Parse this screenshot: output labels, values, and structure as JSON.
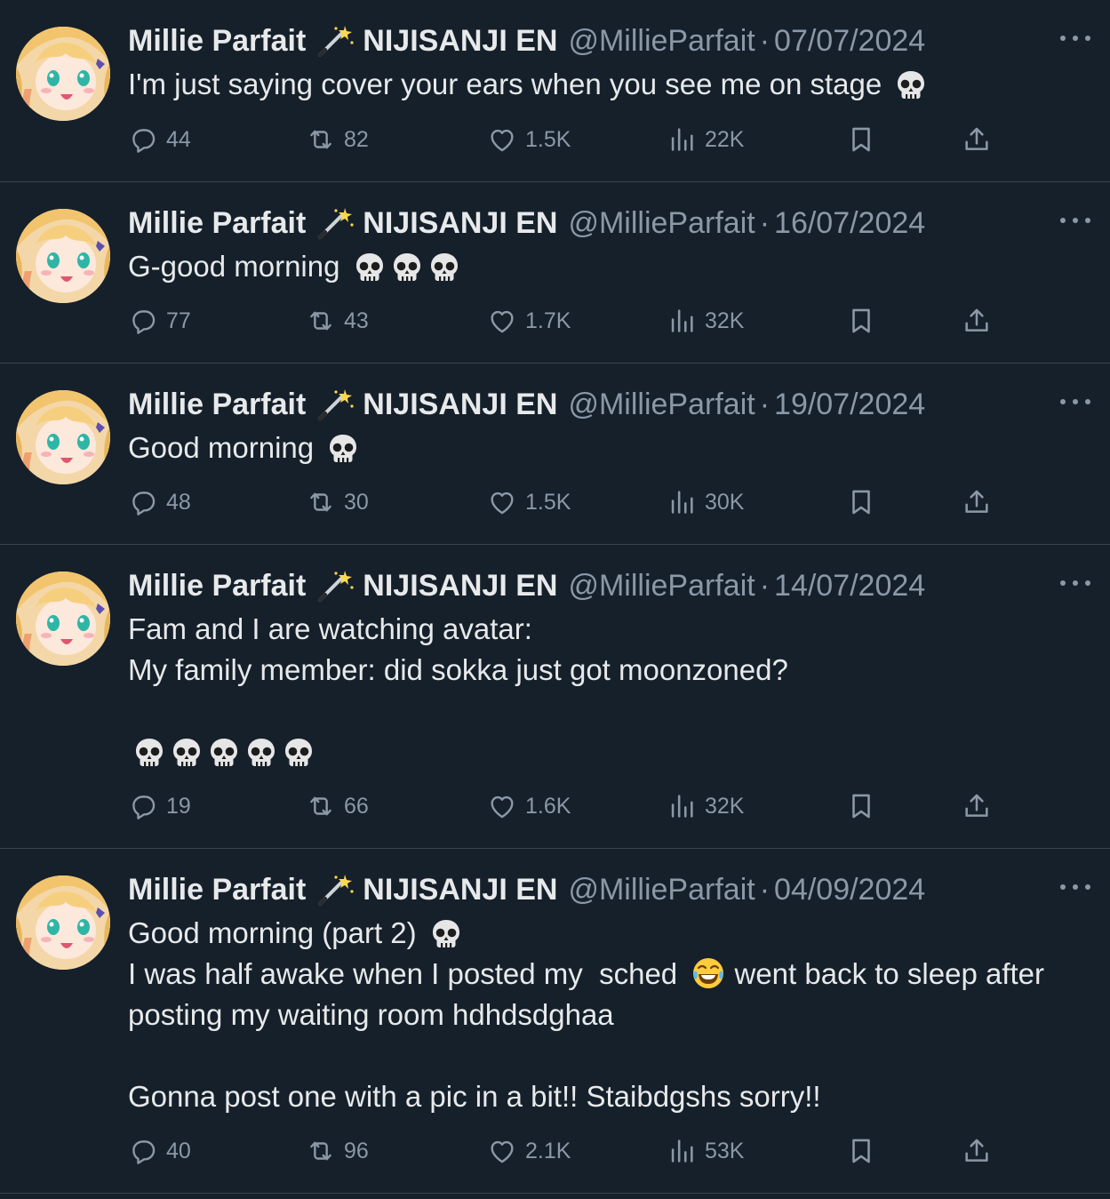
{
  "tweets": [
    {
      "name": "Millie Parfait",
      "org": "NIJISANJI EN",
      "handle": "@MillieParfait",
      "date": "07/07/2024",
      "text_lines": [
        "I'm just saying cover your ears when you see me on stage 💀"
      ],
      "replies": "44",
      "retweets": "82",
      "likes": "1.5K",
      "views": "22K"
    },
    {
      "name": "Millie Parfait",
      "org": "NIJISANJI EN",
      "handle": "@MillieParfait",
      "date": "16/07/2024",
      "text_lines": [
        "G-good morning 💀💀💀"
      ],
      "replies": "77",
      "retweets": "43",
      "likes": "1.7K",
      "views": "32K"
    },
    {
      "name": "Millie Parfait",
      "org": "NIJISANJI EN",
      "handle": "@MillieParfait",
      "date": "19/07/2024",
      "text_lines": [
        "Good morning 💀"
      ],
      "replies": "48",
      "retweets": "30",
      "likes": "1.5K",
      "views": "30K"
    },
    {
      "name": "Millie Parfait",
      "org": "NIJISANJI EN",
      "handle": "@MillieParfait",
      "date": "14/07/2024",
      "text_lines": [
        "Fam and I are watching avatar:",
        "My family member: did sokka just got moonzoned?",
        "",
        "💀💀💀💀💀"
      ],
      "replies": "19",
      "retweets": "66",
      "likes": "1.6K",
      "views": "32K"
    },
    {
      "name": "Millie Parfait",
      "org": "NIJISANJI EN",
      "handle": "@MillieParfait",
      "date": "04/09/2024",
      "text_lines": [
        "Good morning (part 2) 💀",
        "I was half awake when I posted my  sched 😂 went back to sleep after",
        "posting my waiting room hdhdsdghaa",
        "",
        "Gonna post one with a pic in a bit!! Staibdgshs sorry!!"
      ],
      "replies": "40",
      "retweets": "96",
      "likes": "2.1K",
      "views": "53K"
    }
  ],
  "icons": {
    "reply": "reply-icon",
    "retweet": "retweet-icon",
    "like": "heart-icon",
    "views": "views-icon",
    "bookmark": "bookmark-icon",
    "share": "share-icon",
    "more": "more-icon"
  },
  "colors": {
    "background": "#15202b",
    "text": "#e7e9ea",
    "muted": "#8b98a5",
    "divider": "#38444d"
  }
}
